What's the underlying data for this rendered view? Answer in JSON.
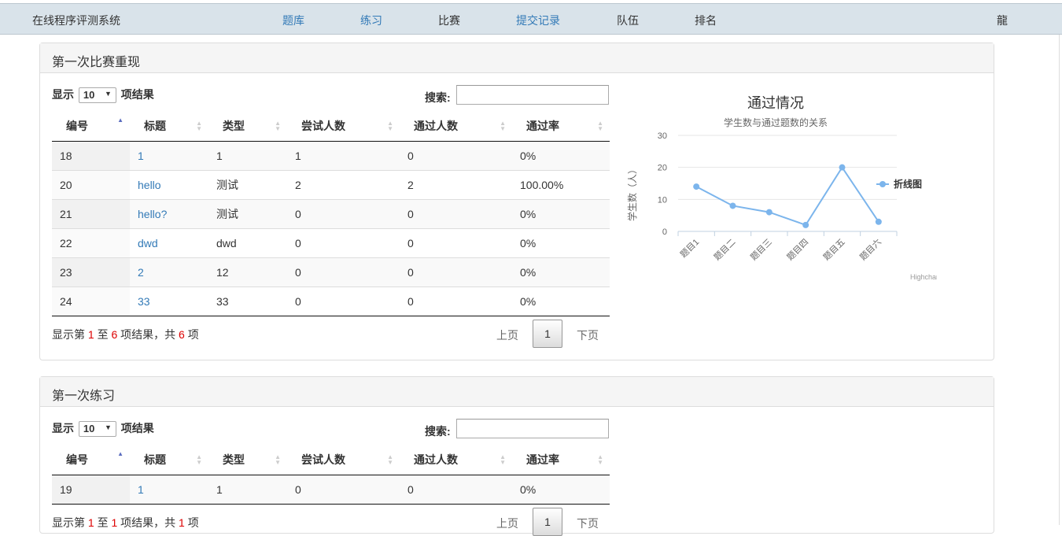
{
  "nav": {
    "brand": "在线程序评测系统",
    "items": [
      "题库",
      "练习",
      "比赛",
      "提交记录",
      "队伍",
      "排名"
    ],
    "user": "龍"
  },
  "panels": [
    {
      "title": "第一次比赛重现",
      "length_label_pre": "显示",
      "length_value": "10",
      "length_label_post": "项结果",
      "search_label": "搜索:",
      "columns": [
        "编号",
        "标题",
        "类型",
        "尝试人数",
        "通过人数",
        "通过率"
      ],
      "rows": [
        [
          "18",
          "1",
          "1",
          "1",
          "0",
          "0%"
        ],
        [
          "20",
          "hello",
          "测试",
          "2",
          "2",
          "100.00%"
        ],
        [
          "21",
          "hello?",
          "测试",
          "0",
          "0",
          "0%"
        ],
        [
          "22",
          "dwd",
          "dwd",
          "0",
          "0",
          "0%"
        ],
        [
          "23",
          "2",
          "12",
          "0",
          "0",
          "0%"
        ],
        [
          "24",
          "33",
          "33",
          "0",
          "0",
          "0%"
        ]
      ],
      "info": {
        "pre": "显示第 ",
        "from": "1",
        "mid1": " 至 ",
        "to": "6",
        "mid2": " 项结果，共 ",
        "total": "6",
        "post": " 项"
      },
      "pager": {
        "prev": "上页",
        "current": "1",
        "next": "下页"
      }
    },
    {
      "title": "第一次练习",
      "length_label_pre": "显示",
      "length_value": "10",
      "length_label_post": "项结果",
      "search_label": "搜索:",
      "columns": [
        "编号",
        "标题",
        "类型",
        "尝试人数",
        "通过人数",
        "通过率"
      ],
      "rows": [
        [
          "19",
          "1",
          "1",
          "0",
          "0",
          "0%"
        ]
      ],
      "info": {
        "pre": "显示第 ",
        "from": "1",
        "mid1": " 至 ",
        "to": "1",
        "mid2": " 项结果，共 ",
        "total": "1",
        "post": " 项"
      },
      "pager": {
        "prev": "上页",
        "current": "1",
        "next": "下页"
      }
    }
  ],
  "chart_data": {
    "type": "line",
    "title": "通过情况",
    "subtitle": "学生数与通过题数的关系",
    "ylabel": "学生数（人）",
    "xlabel": "",
    "categories": [
      "题目1",
      "题目二",
      "题目三",
      "题目四",
      "题目五",
      "题目六"
    ],
    "series": [
      {
        "name": "折线图",
        "values": [
          14,
          8,
          6,
          2,
          20,
          3
        ]
      }
    ],
    "ylim": [
      0,
      30
    ],
    "yticks": [
      0,
      10,
      20,
      30
    ],
    "grid": true,
    "legend": "right",
    "color": "#7cb5ec",
    "credits": "Highcharts.com"
  }
}
